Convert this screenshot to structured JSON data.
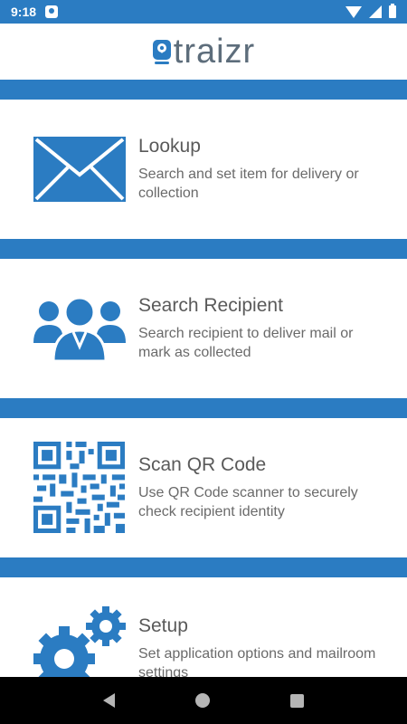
{
  "status_bar": {
    "time": "9:18",
    "icons": [
      "notification-icon",
      "wifi-icon",
      "signal-icon",
      "battery-icon"
    ]
  },
  "header": {
    "logo_text": "traizr",
    "logo_icon": "location-pin-icon"
  },
  "colors": {
    "accent": "#2b7cc2",
    "text_primary": "#5a5a5a",
    "logo_text": "#5d6d7b"
  },
  "menu": {
    "items": [
      {
        "title": "Lookup",
        "description": "Search and set item for delivery or collection",
        "icon": "envelope-icon"
      },
      {
        "title": "Search Recipient",
        "description": "Search recipient to deliver mail or mark as collected",
        "icon": "people-group-icon"
      },
      {
        "title": "Scan QR Code",
        "description": "Use QR Code scanner to securely check recipient identity",
        "icon": "qr-code-icon"
      },
      {
        "title": "Setup",
        "description": "Set application options and mailroom settings",
        "icon": "gears-icon"
      }
    ]
  },
  "nav_bar": {
    "buttons": [
      "back-icon",
      "home-icon",
      "recents-icon"
    ]
  }
}
